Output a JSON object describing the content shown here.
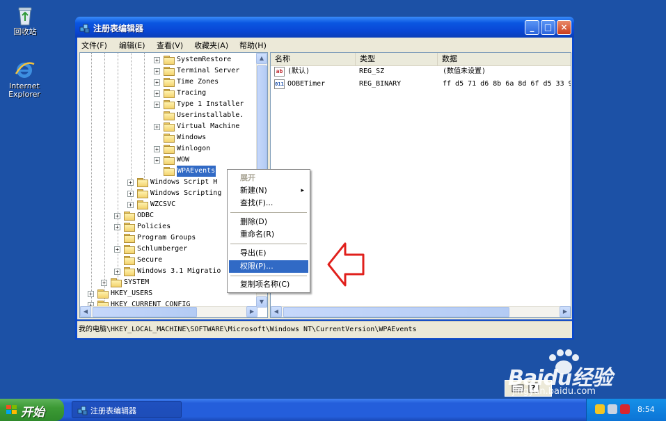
{
  "desktop": {
    "icons": [
      {
        "icon": "recycle-bin-icon",
        "label": "回收站"
      },
      {
        "icon": "internet-explorer-icon",
        "label": "Internet Explorer"
      }
    ]
  },
  "window": {
    "title": "注册表编辑器",
    "controls": {
      "minimize": "_",
      "maximize": "□",
      "close": "×"
    },
    "menu": [
      "文件(F)",
      "编辑(E)",
      "查看(V)",
      "收藏夹(A)",
      "帮助(H)"
    ]
  },
  "tree": {
    "items": [
      {
        "label": "SystemRestore",
        "expander": "+"
      },
      {
        "label": "Terminal Server",
        "expander": "+"
      },
      {
        "label": "Time Zones",
        "expander": "+"
      },
      {
        "label": "Tracing",
        "expander": "+"
      },
      {
        "label": "Type 1 Installer",
        "expander": "+"
      },
      {
        "label": "Userinstallable.",
        "expander": ""
      },
      {
        "label": "Virtual Machine",
        "expander": "+"
      },
      {
        "label": "Windows",
        "expander": ""
      },
      {
        "label": "Winlogon",
        "expander": "+"
      },
      {
        "label": "WOW",
        "expander": "+"
      },
      {
        "label": "WPAEvents",
        "expander": "",
        "selected": true
      },
      {
        "label": "Windows Script H",
        "expander": "+"
      },
      {
        "label": "Windows Scripting",
        "expander": "+"
      },
      {
        "label": "WZCSVC",
        "expander": "+"
      },
      {
        "label": "ODBC",
        "expander": "+"
      },
      {
        "label": "Policies",
        "expander": "+"
      },
      {
        "label": "Program Groups",
        "expander": ""
      },
      {
        "label": "Schlumberger",
        "expander": "+"
      },
      {
        "label": "Secure",
        "expander": ""
      },
      {
        "label": "Windows 3.1 Migratio",
        "expander": "+"
      },
      {
        "label": "SYSTEM",
        "expander": "+"
      },
      {
        "label": "HKEY_USERS",
        "expander": "+"
      },
      {
        "label": "HKEY_CURRENT_CONFIG",
        "expander": "+"
      }
    ]
  },
  "list": {
    "columns": [
      "名称",
      "类型",
      "数据"
    ],
    "rows": [
      {
        "icon": "ab",
        "name": "(默认)",
        "type": "REG_SZ",
        "data": "(数值未设置)"
      },
      {
        "icon": "011",
        "name": "OOBETimer",
        "type": "REG_BINARY",
        "data": "ff d5 71 d6 8b 6a 8d 6f d5 33 9"
      }
    ]
  },
  "context_menu": {
    "items": [
      {
        "label": "展开",
        "disabled": true
      },
      {
        "label": "新建(N)",
        "submenu": "▸"
      },
      {
        "label": "查找(F)..."
      },
      {
        "label": "删除(D)"
      },
      {
        "label": "重命名(R)"
      },
      {
        "label": "导出(E)"
      },
      {
        "label": "权限(P)...",
        "highlighted": true
      },
      {
        "label": "复制项名称(C)"
      }
    ]
  },
  "status_bar": {
    "path": "我的电脑\\HKEY_LOCAL_MACHINE\\SOFTWARE\\Microsoft\\Windows NT\\CurrentVersion\\WPAEvents"
  },
  "taskbar": {
    "start_label": "开始",
    "task_label": "注册表编辑器",
    "clock": "8:54"
  },
  "watermark": {
    "brand": "Baidu经验",
    "url": "jingyan.baidu.com"
  },
  "colors": {
    "desktop": "#1c51a6",
    "selection": "#316ac5",
    "annotation_arrow": "#e0201c"
  }
}
